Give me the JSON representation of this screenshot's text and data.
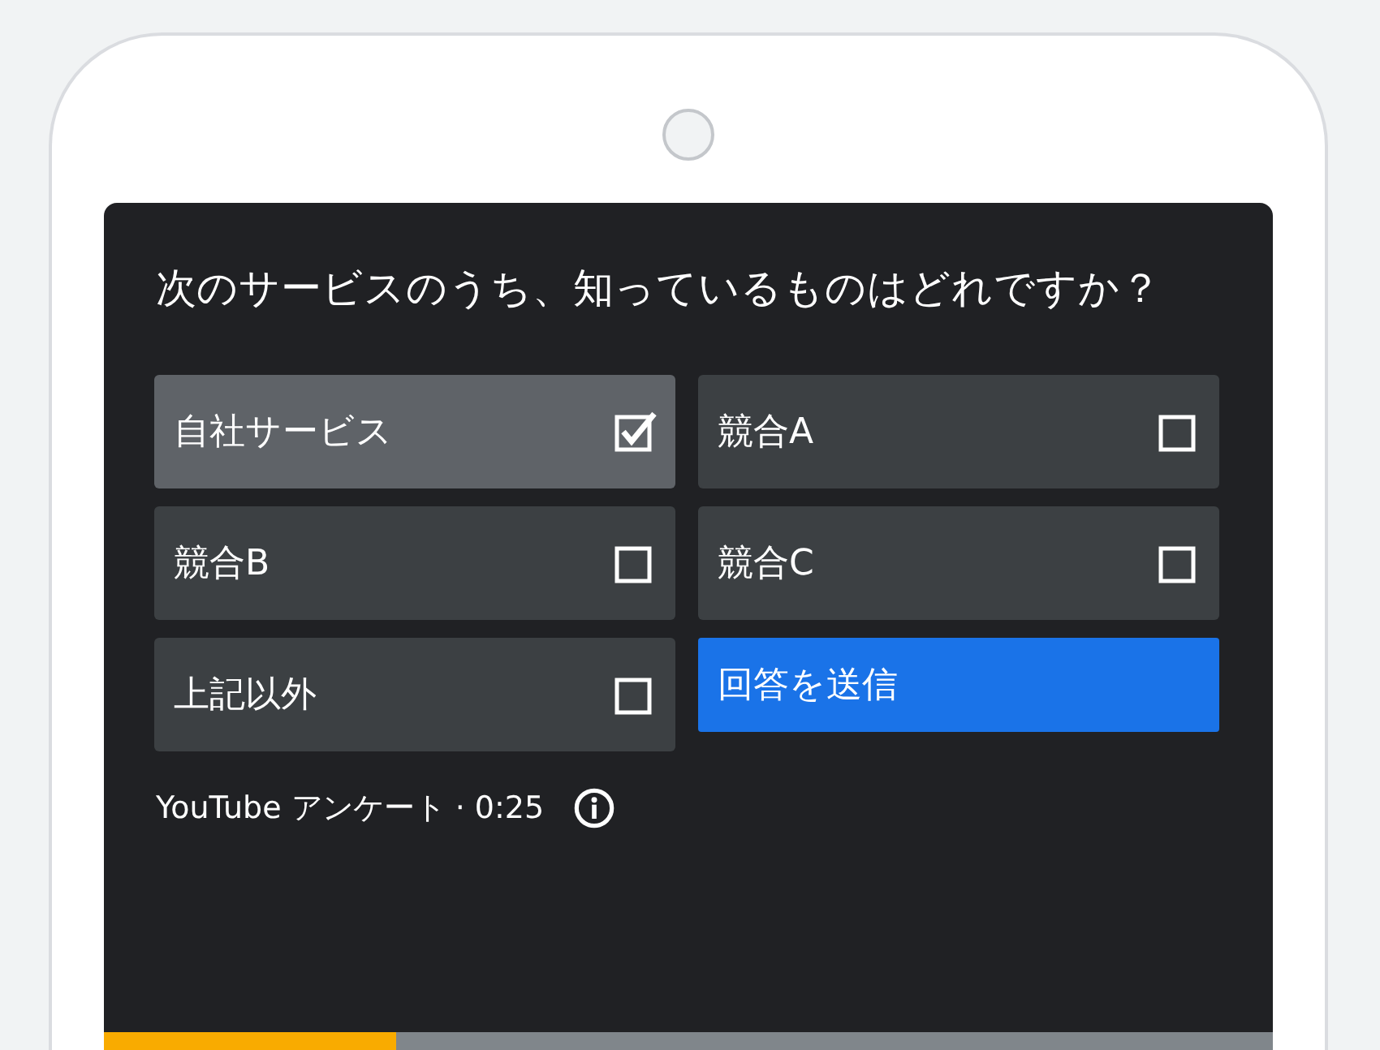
{
  "poll": {
    "question": "次のサービスのうち、知っているものはどれですか？",
    "options": [
      {
        "label": "自社サービス",
        "checked": true
      },
      {
        "label": "競合A",
        "checked": false
      },
      {
        "label": "競合B",
        "checked": false
      },
      {
        "label": "競合C",
        "checked": false
      },
      {
        "label": "上記以外",
        "checked": false
      }
    ],
    "submit": "回答を送信",
    "footer": "YouTube アンケート · 0:25",
    "progress": {
      "level": 0.25
    }
  }
}
